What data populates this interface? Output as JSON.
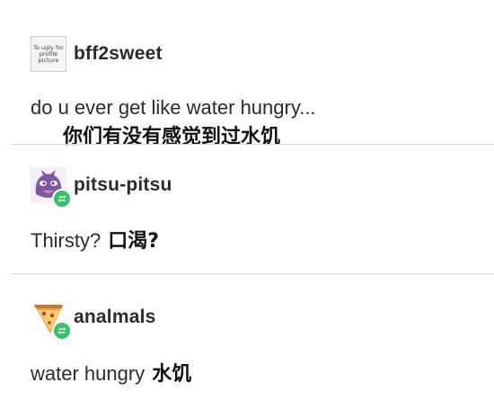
{
  "posts": [
    {
      "username": "bff2sweet",
      "avatar_text": "To ugly for profile picture",
      "text": "do u ever get like water hungry...",
      "translation": "你们有没有感觉到过水饥"
    },
    {
      "username": "pitsu-pitsu",
      "avatar_icon": "gengar-avatar-icon",
      "text": "Thirsty?",
      "translation": "口渴?"
    },
    {
      "username": "analmals",
      "avatar_icon": "pizza-slice-avatar-icon",
      "text": "water hungry",
      "translation": "水饥"
    }
  ],
  "colors": {
    "reblog_badge": "#36c26b",
    "divider": "#d6d6d6"
  }
}
